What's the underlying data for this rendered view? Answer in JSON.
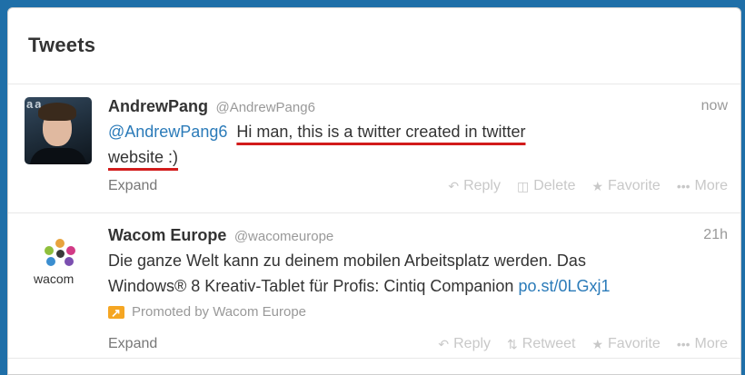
{
  "panel": {
    "title": "Tweets"
  },
  "tweets": [
    {
      "name": "AndrewPang",
      "handle": "@AndrewPang6",
      "time": "now",
      "mention": "@AndrewPang6",
      "text_part1": "Hi man, this is a twitter created in twitter",
      "text_part2": "website :)",
      "expand": "Expand",
      "actions": [
        "Reply",
        "Delete",
        "Favorite",
        "More"
      ],
      "avatar_text": "aa"
    },
    {
      "name": "Wacom Europe",
      "handle": "@wacomeurope",
      "time": "21h",
      "text_line1": "Die ganze Welt kann zu deinem mobilen Arbeitsplatz werden. Das",
      "text_line2": "Windows® 8 Kreativ-Tablet für Profis: Cintiq Companion ",
      "link": "po.st/0LGxj1",
      "promoted": "Promoted by Wacom Europe",
      "expand": "Expand",
      "actions": [
        "Reply",
        "Retweet",
        "Favorite",
        "More"
      ],
      "logo_text": "wacom"
    }
  ],
  "icons": {
    "reply": "reply-arrow-icon",
    "delete": "trash-icon",
    "retweet": "retweet-icon",
    "favorite": "star-icon",
    "more": "ellipsis-icon",
    "promoted": "promoted-arrow-icon"
  },
  "colors": {
    "background": "#1f6fa8",
    "link": "#2b7bb9",
    "promoted_badge": "#f5a623",
    "annotation_underline": "#d21b1b"
  }
}
